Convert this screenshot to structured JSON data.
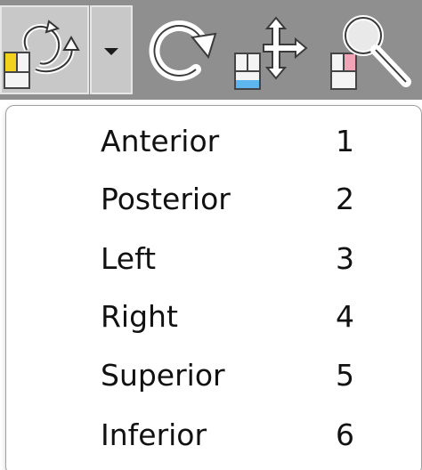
{
  "toolbar": {
    "buttons": [
      {
        "icon": "orientation-cube-icon"
      },
      {
        "icon": "chevron-down-icon"
      },
      {
        "icon": "rotate-icon"
      },
      {
        "icon": "pan-move-icon"
      },
      {
        "icon": "zoom-magnifier-icon"
      }
    ],
    "colors": {
      "background": "#8f8f8f",
      "active_button": "#c8c8c8",
      "orient_accent": "#f2d21c",
      "pan_accent": "#5fb6ef",
      "zoom_accent": "#f2a3b5"
    }
  },
  "menu": {
    "items": [
      {
        "label": "Anterior",
        "shortcut": "1"
      },
      {
        "label": "Posterior",
        "shortcut": "2"
      },
      {
        "label": "Left",
        "shortcut": "3"
      },
      {
        "label": "Right",
        "shortcut": "4"
      },
      {
        "label": "Superior",
        "shortcut": "5"
      },
      {
        "label": "Inferior",
        "shortcut": "6"
      }
    ]
  }
}
